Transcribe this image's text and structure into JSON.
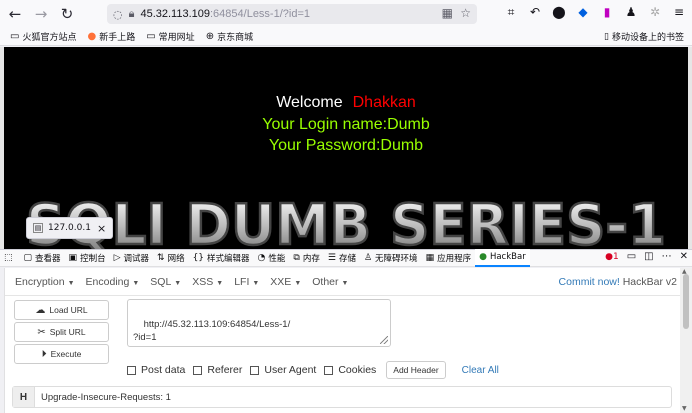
{
  "browser": {
    "url_host": "45.32.113.109",
    "url_rest": ":64854/Less-1/?id=1"
  },
  "bookmarks": [
    {
      "label": "火狐官方站点",
      "icon": "firefox-icon"
    },
    {
      "label": "新手上路",
      "icon": "firefox-icon"
    },
    {
      "label": "常用网址",
      "icon": "folder-icon"
    },
    {
      "label": "京东商城",
      "icon": "globe-icon"
    }
  ],
  "bookmarks_right": "移动设备上的书签",
  "page": {
    "welcome": "Welcome",
    "welcome_name": "Dhakkan",
    "login_name": "Your Login name:Dumb",
    "password": "Your Password:Dumb",
    "banner": "SQLI DUMB SERIES-1",
    "tooltip": "127.0.0.1"
  },
  "devtools": {
    "tabs": [
      {
        "label": "查看器",
        "icon": "inspector-icon"
      },
      {
        "label": "控制台",
        "icon": "console-icon"
      },
      {
        "label": "调试器",
        "icon": "debugger-icon"
      },
      {
        "label": "网络",
        "icon": "network-icon"
      },
      {
        "label": "样式编辑器",
        "icon": "style-editor-icon"
      },
      {
        "label": "性能",
        "icon": "performance-icon"
      },
      {
        "label": "内存",
        "icon": "memory-icon"
      },
      {
        "label": "存储",
        "icon": "storage-icon"
      },
      {
        "label": "无障碍环境",
        "icon": "accessibility-icon"
      },
      {
        "label": "应用程序",
        "icon": "application-icon"
      },
      {
        "label": "HackBar",
        "icon": "hackbar-icon"
      }
    ],
    "error_count": "1"
  },
  "hackbar": {
    "menu": [
      "Encryption",
      "Encoding",
      "SQL",
      "XSS",
      "LFI",
      "XXE",
      "Other"
    ],
    "commit_link": "Commit now!",
    "commit_version": "HackBar v2",
    "load_url": "Load URL",
    "split_url": "Split URL",
    "execute": "Execute",
    "url_value": "http://45.32.113.109:64854/Less-1/\n?id=1",
    "post_data": "Post data",
    "referer": "Referer",
    "user_agent": "User Agent",
    "cookies": "Cookies",
    "add_header": "Add Header",
    "clear_all": "Clear All",
    "header_tag": "H",
    "header_value": "Upgrade-Insecure-Requests: 1"
  },
  "colors": {
    "welcome_name": "#ff0000",
    "login_text": "#99ff00",
    "active_tab": "#0a84ff",
    "link": "#337ab7"
  }
}
